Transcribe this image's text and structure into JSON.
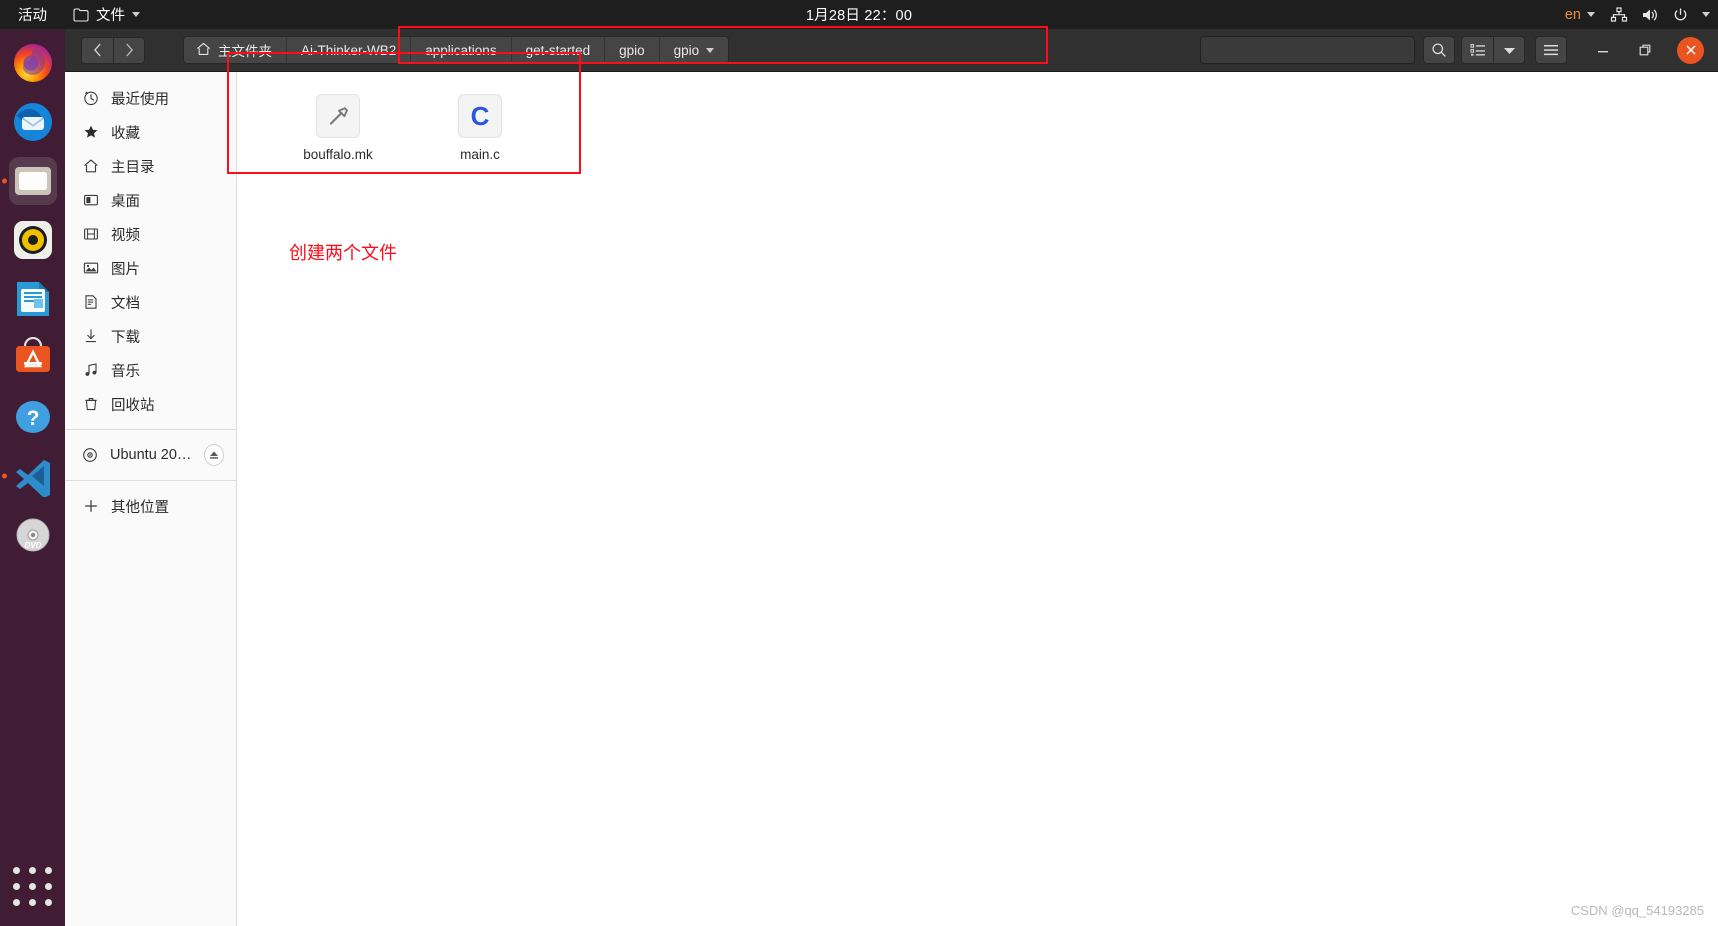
{
  "topbar": {
    "activities": "活动",
    "app_menu": {
      "label": "文件",
      "icon": "folder-icon",
      "caret": "chevron-down-icon"
    },
    "clock": "1月28日 22：00",
    "language": "en",
    "indicators": [
      "network-icon",
      "volume-icon",
      "power-icon",
      "chevron-down-icon"
    ]
  },
  "dock": {
    "items": [
      {
        "name": "firefox",
        "label": "Firefox",
        "running": false
      },
      {
        "name": "thunderbird",
        "label": "Thunderbird",
        "running": false
      },
      {
        "name": "files",
        "label": "文件",
        "running": true,
        "active": true
      },
      {
        "name": "rhythmbox",
        "label": "Rhythmbox",
        "running": false
      },
      {
        "name": "libreoffice-writer",
        "label": "LibreOffice Writer",
        "running": false
      },
      {
        "name": "ubuntu-software",
        "label": "Ubuntu Software",
        "running": false
      },
      {
        "name": "help",
        "label": "帮助",
        "running": false
      },
      {
        "name": "vscode",
        "label": "Visual Studio Code",
        "running": true
      },
      {
        "name": "dvd",
        "label": "Ubuntu 20.0...",
        "running": false
      }
    ],
    "show_apps_label": "显示应用程序"
  },
  "window": {
    "nav": {
      "back": "后退",
      "forward": "前进"
    },
    "breadcrumbs": [
      {
        "label": "主文件夹",
        "icon": "home-icon"
      },
      {
        "label": "Ai-Thinker-WB2"
      },
      {
        "label": "applications"
      },
      {
        "label": "get-started"
      },
      {
        "label": "gpio"
      },
      {
        "label": "gpio",
        "has_caret": true
      }
    ],
    "search": {
      "placeholder": "",
      "value": "",
      "icon": "search-icon"
    },
    "toolbar": {
      "view_list_icon": "list-view-icon",
      "view_caret_icon": "chevron-down-icon",
      "menu_icon": "hamburger-menu-icon"
    },
    "controls": {
      "minimize": "最小化",
      "maximize": "最大化",
      "close": "关闭",
      "close_color": "#e95420"
    }
  },
  "sidebar": {
    "items": [
      {
        "label": "最近使用",
        "icon": "clock-icon"
      },
      {
        "label": "收藏",
        "icon": "star-icon"
      },
      {
        "label": "主目录",
        "icon": "home-icon"
      },
      {
        "label": "桌面",
        "icon": "desktop-icon"
      },
      {
        "label": "视频",
        "icon": "video-icon"
      },
      {
        "label": "图片",
        "icon": "image-icon"
      },
      {
        "label": "文档",
        "icon": "document-icon"
      },
      {
        "label": "下载",
        "icon": "download-icon"
      },
      {
        "label": "音乐",
        "icon": "music-icon"
      },
      {
        "label": "回收站",
        "icon": "trash-icon"
      }
    ],
    "devices": [
      {
        "label": "Ubuntu 20.0...",
        "icon": "disc-icon",
        "eject": "eject-icon"
      }
    ],
    "other": {
      "label": "其他位置",
      "icon": "plus-icon"
    }
  },
  "content": {
    "files": [
      {
        "name": "bouffalo.mk",
        "icon": "makefile-hammer-icon"
      },
      {
        "name": "main.c",
        "icon": "c-source-icon",
        "icon_letter": "C",
        "icon_color": "#2756e0"
      }
    ],
    "annotation": "创建两个文件",
    "annotation_color": "#fc0d1b",
    "watermark": "CSDN @qq_54193285"
  }
}
